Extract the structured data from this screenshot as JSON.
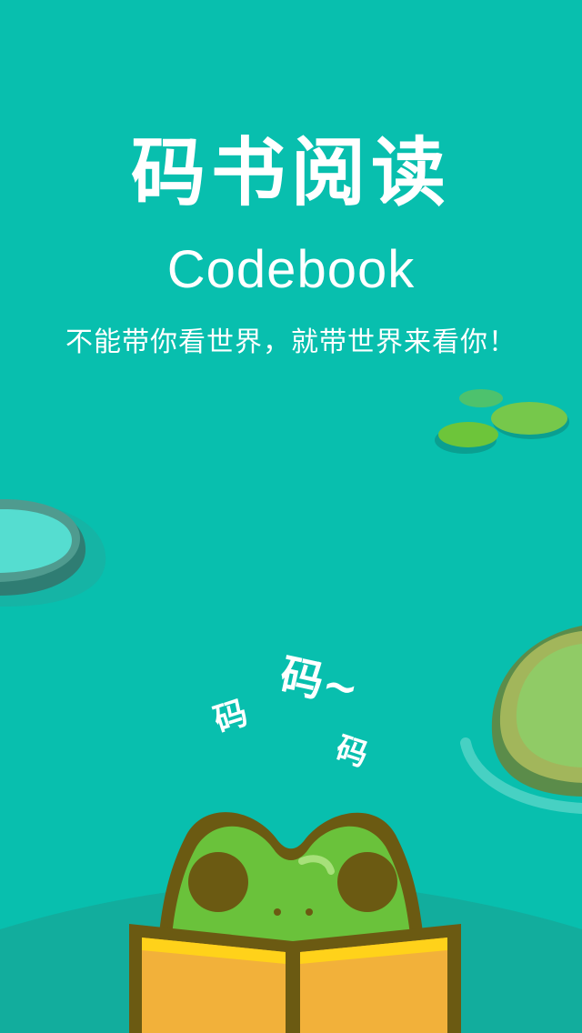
{
  "splash": {
    "app_title": "码书阅读",
    "app_subtitle": "Codebook",
    "slogan": "不能带你看世界，就带世界来看你！",
    "frog_text_1": "码",
    "frog_text_2": "码~",
    "frog_text_3": "码"
  },
  "colors": {
    "background": "#08bfae",
    "text": "#ffffff",
    "frog_green": "#6ac23b",
    "frog_outline": "#6b5a12",
    "book_yellow": "#f2b13a",
    "lily_pad_green": "#8fce57"
  },
  "icons": {
    "frog": "frog-reading-book-icon",
    "lily_pad": "lily-pad-icon"
  }
}
